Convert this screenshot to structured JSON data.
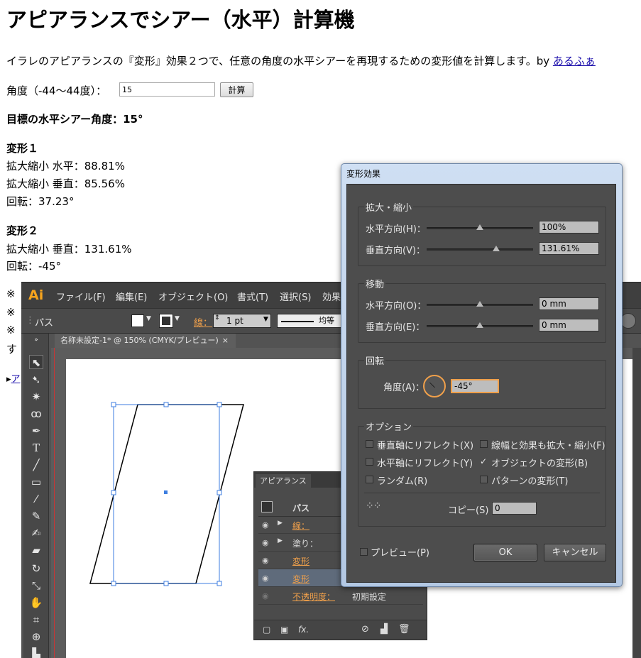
{
  "page": {
    "title": "アピアランスでシアー（水平）計算機",
    "description": "イラレのアピアランスの『変形』効果２つで、任意の角度の水平シアーを再現するための変形値を計算します。by ",
    "author_link": "あるふぁ",
    "angle_label": "角度（-44～44度）：",
    "angle_value": "15",
    "calc_button": "計算",
    "target_line": "目標の水平シアー角度：15°",
    "t1_heading": "変形１",
    "t1_h": "拡大縮小 水平：88.81%",
    "t1_v": "拡大縮小 垂直：85.56%",
    "t1_r": "回転：37.23°",
    "t2_heading": "変形２",
    "t2_v": "拡大縮小 垂直：131.61%",
    "t2_r": "回転：-45°",
    "frag1": "※",
    "frag2": "※",
    "frag3": "※",
    "frag4": "す",
    "frag5": "ア"
  },
  "ai": {
    "logo": "Ai",
    "menus": [
      "ファイル(F)",
      "編集(E)",
      "オブジェクト(O)",
      "書式(T)",
      "選択(S)",
      "効果"
    ],
    "ctrl_path": "パス",
    "ctrl_stroke": "線：",
    "ctrl_stroke_val": "1 pt",
    "ctrl_profile": "均等",
    "doc_tab": "名称未設定-1* @ 150% (CMYK/プレビュー)",
    "doc_tab_close": "×"
  },
  "appearance": {
    "tab": "アピアランス",
    "header": "パス",
    "rows": [
      {
        "label": "線：",
        "value": ""
      },
      {
        "label": "塗り：",
        "value": ""
      },
      {
        "label": "変形",
        "value": ""
      },
      {
        "label": "変形",
        "value": ""
      },
      {
        "label": "不透明度：",
        "value": "初期設定"
      }
    ]
  },
  "dialog": {
    "title": "変形効果",
    "scale_group": "拡大・縮小",
    "scale_h_label": "水平方向(H)：",
    "scale_h_value": "100%",
    "scale_v_label": "垂直方向(V)：",
    "scale_v_value": "131.61%",
    "move_group": "移動",
    "move_h_label": "水平方向(O)：",
    "move_h_value": "0 mm",
    "move_v_label": "垂直方向(E)：",
    "move_v_value": "0 mm",
    "rotate_group": "回転",
    "angle_label": "角度(A)：",
    "angle_value": "-45°",
    "options_group": "オプション",
    "opt_reflect_v": "垂直軸にリフレクト(X)",
    "opt_reflect_h": "水平軸にリフレクト(Y)",
    "opt_random": "ランダム(R)",
    "opt_scale_stroke": "線幅と効果も拡大・縮小(F)",
    "opt_transform_objects": "オブジェクトの変形(B)",
    "opt_transform_patterns": "パターンの変形(T)",
    "copies_label": "コピー(S)",
    "copies_value": "0",
    "preview_label": "プレビュー(P)",
    "ok": "OK",
    "cancel": "キャンセル",
    "check_mark": "✓"
  }
}
